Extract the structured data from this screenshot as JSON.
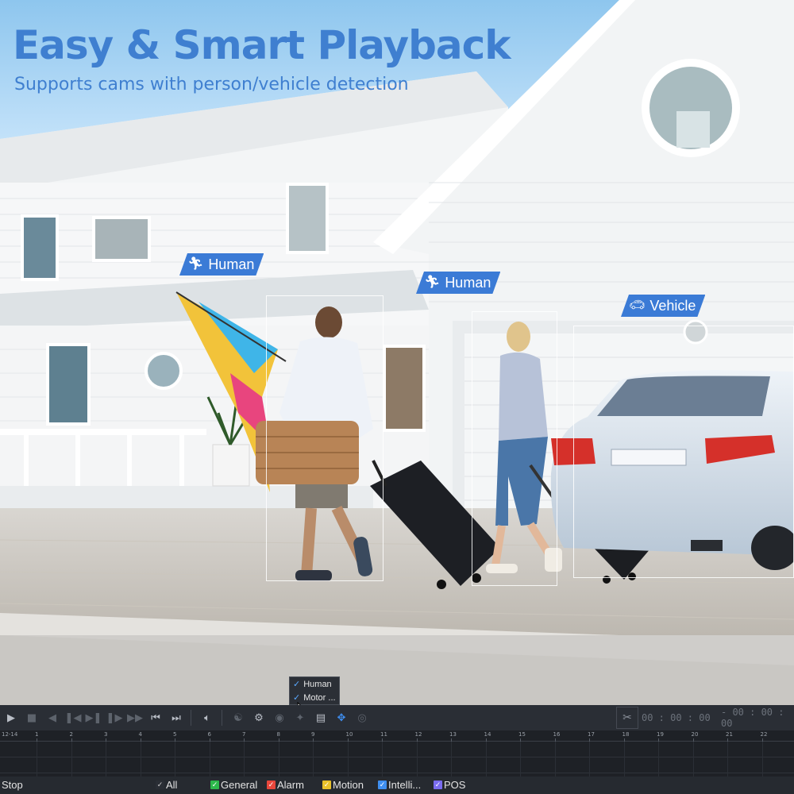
{
  "headline": "Easy & Smart Playback",
  "subheadline": "Supports cams with person/vehicle detection",
  "detections": [
    {
      "label": "Human",
      "icon": "person-running-icon"
    },
    {
      "label": "Human",
      "icon": "person-running-icon"
    },
    {
      "label": "Vehicle",
      "icon": "car-icon"
    }
  ],
  "popup": {
    "items": [
      {
        "label": "Human",
        "checked": true
      },
      {
        "label": "Motor ...",
        "checked": true
      }
    ]
  },
  "toolbar": {
    "icons": [
      "play-icon",
      "stop-icon",
      "step-back-icon",
      "frame-back-icon",
      "frame-forward-icon",
      "step-forward-icon",
      "fast-forward-icon",
      "skip-start-icon",
      "skip-end-icon",
      "volume-icon",
      "person-filter-icon",
      "smart-search-icon",
      "snapshot-icon",
      "pin-icon",
      "screen-icon",
      "motion-filter-icon",
      "settings-lens-icon",
      "scissors-icon"
    ],
    "start_time": "00 : 00 : 00",
    "end_time": "- 00 : 00 : 00"
  },
  "timeline": {
    "date_label": "12-14",
    "hours": [
      "1",
      "2",
      "3",
      "4",
      "5",
      "6",
      "7",
      "8",
      "9",
      "10",
      "11",
      "12",
      "13",
      "14",
      "15",
      "16",
      "17",
      "18",
      "19",
      "20",
      "21",
      "22"
    ]
  },
  "legend": {
    "stop_label": "Stop",
    "items": [
      {
        "label": "All",
        "color": "#2a2e35"
      },
      {
        "label": "General",
        "color": "#2db84b"
      },
      {
        "label": "Alarm",
        "color": "#e8473c"
      },
      {
        "label": "Motion",
        "color": "#e8c12a"
      },
      {
        "label": "Intelli...",
        "color": "#3f8ff0"
      },
      {
        "label": "POS",
        "color": "#7a6cf0"
      }
    ]
  },
  "colors": {
    "headline": "#3f7fd0",
    "tag": "#3b7bd6",
    "player_bg": "#22262c"
  }
}
